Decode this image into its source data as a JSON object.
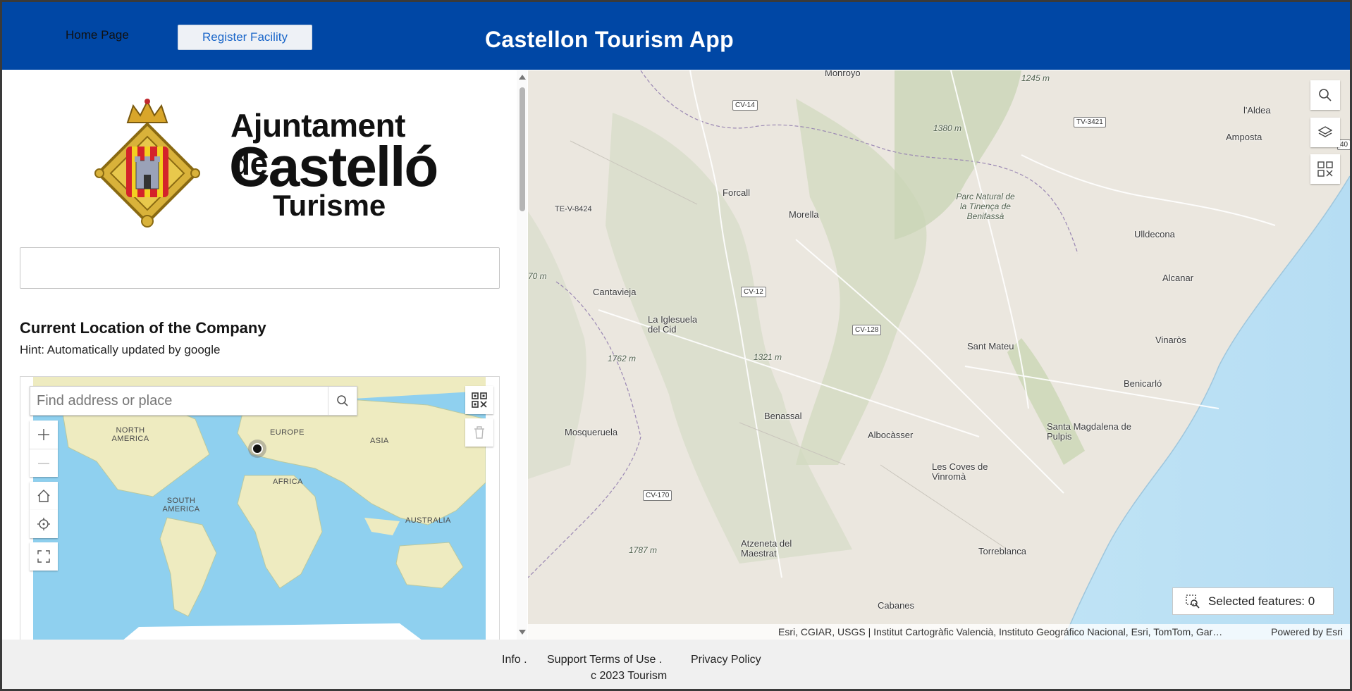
{
  "header": {
    "nav_home": "Home Page",
    "nav_register": "Register Facility",
    "app_title": "Castellon Tourism App",
    "color": "#0047a5"
  },
  "logo": {
    "line1": "Ajuntament de",
    "line2": "Castelló",
    "line3": "Turisme"
  },
  "form": {
    "section_title": "Current Location of the Company",
    "hint": "Hint: Automatically updated by google",
    "mini_map": {
      "search_placeholder": "Find address or place",
      "continents": [
        "NORTH AMERICA",
        "EUROPE",
        "ASIA",
        "AFRICA",
        "SOUTH AMERICA",
        "AUSTRALIA"
      ]
    }
  },
  "main_map": {
    "places": [
      "Monroyo",
      "l'Aldea",
      "Amposta",
      "Forcall",
      "Morella",
      "Parc Natural de la Tinença de Benifassà",
      "Ulldecona",
      "Alcanar",
      "Cantavieja",
      "La Iglesuela del Cid",
      "Sant Mateu",
      "Vinaròs",
      "Benicarló",
      "Benassal",
      "Albocàsser",
      "Mosqueruela",
      "Santa Magdalena de Pulpis",
      "Les Coves de Vinromà",
      "Torreblanca",
      "Atzeneta del Maestrat",
      "Cabanes"
    ],
    "elevations": [
      "1245 m",
      "1380 m",
      "1762 m",
      "1321 m",
      "1787 m",
      "70 m"
    ],
    "roads": [
      "CV-14",
      "TV-3421",
      "TE-V-8424",
      "CV-12",
      "CV-128",
      "CV-170",
      "40"
    ],
    "selected_features": "Selected features: 0",
    "attribution": "Esri, CGIAR, USGS | Institut Cartogràfic Valencià, Instituto Geográfico Nacional, Esri, TomTom, Gar…",
    "powered_by": "Powered by Esri"
  },
  "footer": {
    "info": "Info .",
    "support": "Support Terms of Use .",
    "privacy": "Privacy Policy",
    "copyright": "c 2023 Tourism"
  }
}
